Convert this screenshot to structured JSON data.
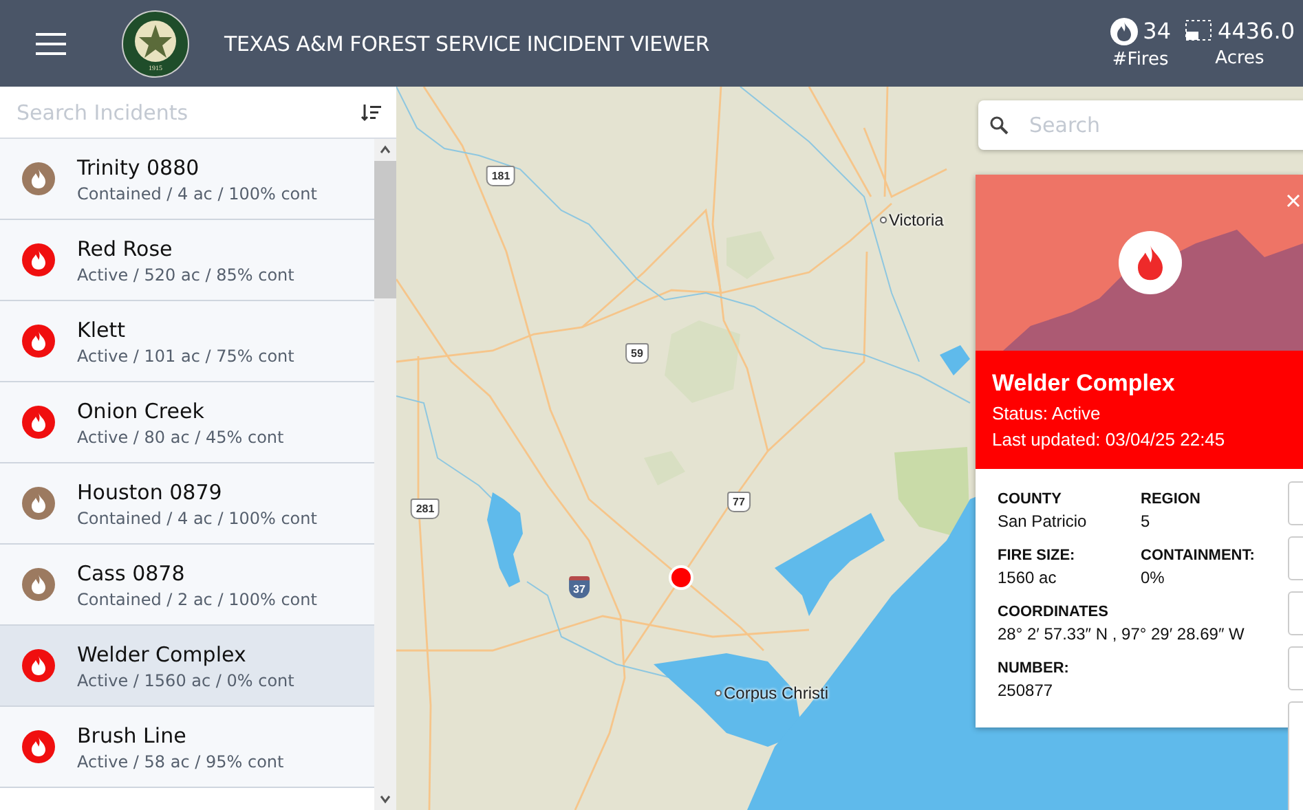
{
  "header": {
    "title": "TEXAS A&M FOREST SERVICE INCIDENT VIEWER",
    "logo_year": "1915",
    "stats": [
      {
        "kind": "fires",
        "value": "34",
        "label": "#Fires"
      },
      {
        "kind": "acres",
        "value": "4436.0",
        "label": "Acres"
      }
    ]
  },
  "sidebar": {
    "search": {
      "placeholder": "Search Incidents"
    },
    "incidents": [
      {
        "name": "Trinity 0880",
        "summary": "Contained / 4 ac / 100% cont",
        "kind": "contained",
        "selected": false
      },
      {
        "name": "Red Rose",
        "summary": "Active / 520 ac / 85% cont",
        "kind": "active",
        "selected": false
      },
      {
        "name": "Klett",
        "summary": "Active / 101 ac / 75% cont",
        "kind": "active",
        "selected": false
      },
      {
        "name": "Onion Creek",
        "summary": "Active / 80 ac / 45% cont",
        "kind": "active",
        "selected": false
      },
      {
        "name": "Houston 0879",
        "summary": "Contained / 4 ac / 100% cont",
        "kind": "contained",
        "selected": false
      },
      {
        "name": "Cass 0878",
        "summary": "Contained / 2 ac / 100% cont",
        "kind": "contained",
        "selected": false
      },
      {
        "name": "Welder Complex",
        "summary": "Active / 1560 ac / 0% cont",
        "kind": "active",
        "selected": true
      },
      {
        "name": "Brush Line",
        "summary": "Active / 58 ac / 95% cont",
        "kind": "active",
        "selected": false
      }
    ]
  },
  "map": {
    "search": {
      "placeholder": "Search"
    },
    "labels": [
      {
        "kind": "city",
        "text": "Victoria"
      },
      {
        "kind": "city",
        "text": "Corpus Christi"
      },
      {
        "kind": "us-highway",
        "text": "181"
      },
      {
        "kind": "us-highway",
        "text": "59"
      },
      {
        "kind": "us-highway",
        "text": "281"
      },
      {
        "kind": "us-highway",
        "text": "77"
      },
      {
        "kind": "interstate",
        "text": "37"
      }
    ],
    "popup": {
      "title": "Welder Complex",
      "status": "Status: Active",
      "updated": "Last updated: 03/04/25 22:45",
      "detail_rows": [
        [
          {
            "label": "COUNTY",
            "value": "San Patricio"
          },
          {
            "label": "REGION",
            "value": "5"
          }
        ],
        [
          {
            "label": "FIRE SIZE:",
            "value": "1560 ac"
          },
          {
            "label": "CONTAINMENT:",
            "value": "0%"
          }
        ],
        [
          {
            "label": "COORDINATES",
            "value": "28° 2′ 57.33″ N , 97° 29′ 28.69″ W"
          }
        ],
        [
          {
            "label": "NUMBER:",
            "value": "250877"
          }
        ]
      ]
    }
  }
}
